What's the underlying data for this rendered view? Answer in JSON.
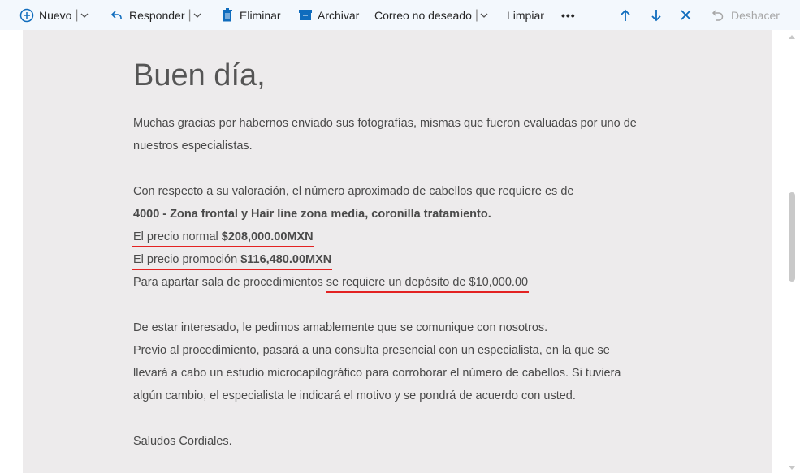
{
  "toolbar": {
    "new_label": "Nuevo",
    "reply_label": "Responder",
    "delete_label": "Eliminar",
    "archive_label": "Archivar",
    "junk_label": "Correo no deseado",
    "sweep_label": "Limpiar",
    "more_label": "•••",
    "undo_label": "Deshacer",
    "icons": [
      "plus-circle-icon",
      "reply-icon",
      "trash-icon",
      "archive-icon",
      "arrow-up-icon",
      "arrow-down-icon",
      "close-icon",
      "undo-icon"
    ],
    "accent_color": "#0f6cbd"
  },
  "email": {
    "greeting": "Buen día,",
    "p1_line1": "Muchas gracias por habernos enviado sus fotografías, mismas que fueron evaluadas por uno de",
    "p1_line2": "nuestros especialistas.",
    "p2_line1": "Con respecto a su valoración, el número aproximado de cabellos que requiere es de",
    "p2_line2_bold": "4000 - Zona frontal y Hair line zona media, coronilla tratamiento.",
    "normal_price_label": "El precio normal",
    "normal_price_value": "$208,000.00MXN",
    "promo_price_label": "El precio promoción",
    "promo_price_value": "$116,480.00MXN",
    "deposit_prefix": "Para apartar sala de procedimientos",
    "deposit_text": "se requiere un depósito de $10,000.00",
    "p3_line1": "De estar interesado, le pedimos amablemente que se comunique con nosotros.",
    "p3_line2": "Previo al procedimiento, pasará a una consulta presencial con un especialista, en la que se",
    "p3_line3": "llevará a cabo un estudio microcapilográfico para corroborar el número de cabellos. Si tuviera",
    "p3_line4": "algún cambio, el especialista le indicará el motivo y se pondrá de acuerdo con usted.",
    "closing": "Saludos Cordiales.",
    "highlight_color": "#e32222"
  }
}
